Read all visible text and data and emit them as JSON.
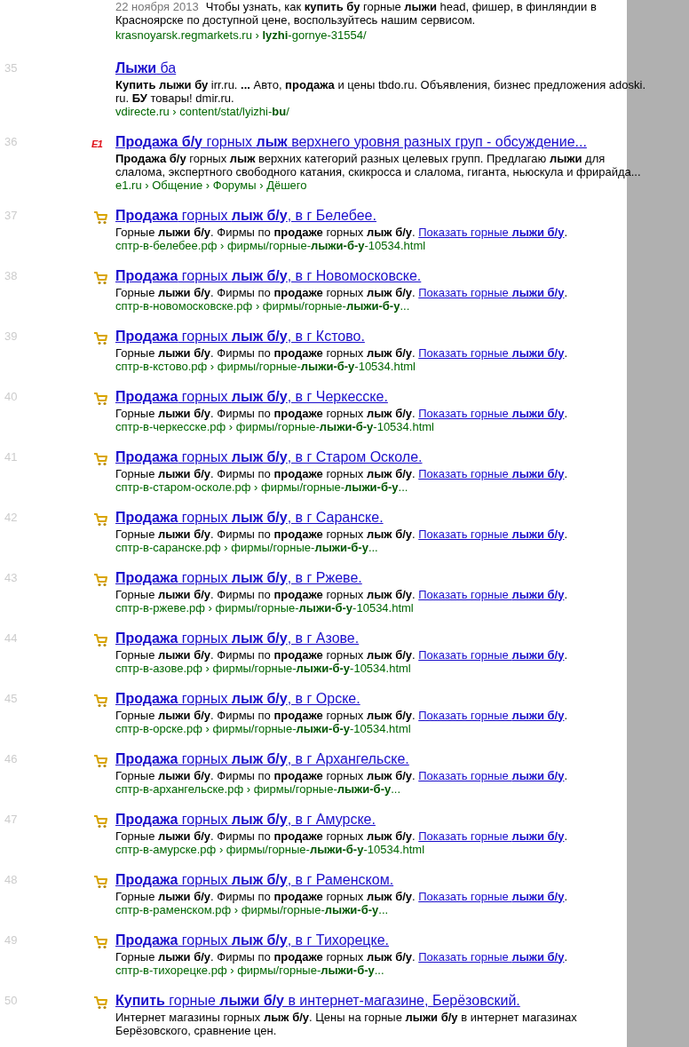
{
  "partial_result": {
    "date": "22 ноября 2013",
    "snippet_lines": [
      "Чтобы узнать, как **купить бу** горные **лыжи** head, фишер, в финляндии в",
      "Красноярске по доступной цене, воспользуйтесь нашим сервисом."
    ],
    "url": "krasnoyarsk.regmarkets.ru › **lyzhi**-gornye-31554/"
  },
  "results": [
    {
      "number": "35",
      "favicon": {
        "kind": "none"
      },
      "title": "**Лыжи** ба",
      "snippet": "**Купить лыжи бу** irr.ru. **...** Авто, **продажа** и цены tbdo.ru. Объявления, бизнес предложения adoski. ru. **БУ** товары! dmir.ru.",
      "url": "vdirecte.ru › content/stat/lyizhi-**bu**/"
    },
    {
      "number": "36",
      "favicon": {
        "kind": "text",
        "text": "E1"
      },
      "title": "**Продажа б/у** горных **лыж** верхнего уровня разных груп - обсуждение...",
      "snippet": "**Продажа б/у** горных **лыж** верхних категорий разных целевых групп. Предлагаю **лыжи** для слалома, экспертного свободного катания, скикросса и слалома, гиганта, ньюскула и фрирайда...",
      "url": "e1.ru › Общение › Форумы › Дёшего"
    },
    {
      "number": "37",
      "favicon": {
        "kind": "cart"
      },
      "title": "**Продажа** горных **лыж б/у**, в г Белебее.",
      "snippet": "Горные **лыжи б/у**. Фирмы по **продаже** горных **лыж б/у**.",
      "more_link": "Показать горные **лыжи б/у**",
      "more_tail": ".",
      "url": "сптр-в-белебее.рф › фирмы/горные-**лыжи-б-у**-10534.html"
    },
    {
      "number": "38",
      "favicon": {
        "kind": "cart"
      },
      "title": "**Продажа** горных **лыж б/у**, в г Новомосковске.",
      "snippet": "Горные **лыжи б/у**. Фирмы по **продаже** горных **лыж б/у**.",
      "more_link": "Показать горные **лыжи б/у**",
      "more_tail": ".",
      "url": "сптр-в-новомосковске.рф › фирмы/горные-**лыжи-б-у**..."
    },
    {
      "number": "39",
      "favicon": {
        "kind": "cart"
      },
      "title": "**Продажа** горных **лыж б/у**, в г Кстово.",
      "snippet": "Горные **лыжи б/у**. Фирмы по **продаже** горных **лыж б/у**.",
      "more_link": "Показать горные **лыжи б/у**",
      "more_tail": ".",
      "url": "сптр-в-кстово.рф › фирмы/горные-**лыжи-б-у**-10534.html"
    },
    {
      "number": "40",
      "favicon": {
        "kind": "cart"
      },
      "title": "**Продажа** горных **лыж б/у**, в г Черкесске.",
      "snippet": "Горные **лыжи б/у**. Фирмы по **продаже** горных **лыж б/у**.",
      "more_link": "Показать горные **лыжи б/у**",
      "more_tail": ".",
      "url": "сптр-в-черкесске.рф › фирмы/горные-**лыжи-б-у**-10534.html"
    },
    {
      "number": "41",
      "favicon": {
        "kind": "cart"
      },
      "title": "**Продажа** горных **лыж б/у**, в г Старом Осколе.",
      "snippet": "Горные **лыжи б/у**. Фирмы по **продаже** горных **лыж б/у**.",
      "more_link": "Показать горные **лыжи б/у**",
      "more_tail": ".",
      "url": "сптр-в-старом-осколе.рф › фирмы/горные-**лыжи-б-у**..."
    },
    {
      "number": "42",
      "favicon": {
        "kind": "cart"
      },
      "title": "**Продажа** горных **лыж б/у**, в г Саранске.",
      "snippet": "Горные **лыжи б/у**. Фирмы по **продаже** горных **лыж б/у**.",
      "more_link": "Показать горные **лыжи б/у**",
      "more_tail": ".",
      "url": "сптр-в-саранске.рф › фирмы/горные-**лыжи-б-у**..."
    },
    {
      "number": "43",
      "favicon": {
        "kind": "cart"
      },
      "title": "**Продажа** горных **лыж б/у**, в г Ржеве.",
      "snippet": "Горные **лыжи б/у**. Фирмы по **продаже** горных **лыж б/у**.",
      "more_link": "Показать горные **лыжи б/у**",
      "more_tail": ".",
      "url": "сптр-в-ржеве.рф › фирмы/горные-**лыжи-б-у**-10534.html"
    },
    {
      "number": "44",
      "favicon": {
        "kind": "cart"
      },
      "title": "**Продажа** горных **лыж б/у**, в г Азове.",
      "snippet": "Горные **лыжи б/у**. Фирмы по **продаже** горных **лыж б/у**.",
      "more_link": "Показать горные **лыжи б/у**",
      "more_tail": ".",
      "url": "сптр-в-азове.рф › фирмы/горные-**лыжи-б-у**-10534.html"
    },
    {
      "number": "45",
      "favicon": {
        "kind": "cart"
      },
      "title": "**Продажа** горных **лыж б/у**, в г Орске.",
      "snippet": "Горные **лыжи б/у**. Фирмы по **продаже** горных **лыж б/у**.",
      "more_link": "Показать горные **лыжи б/у**",
      "more_tail": ".",
      "url": "сптр-в-орске.рф › фирмы/горные-**лыжи-б-у**-10534.html"
    },
    {
      "number": "46",
      "favicon": {
        "kind": "cart"
      },
      "title": "**Продажа** горных **лыж б/у**, в г Архангельске.",
      "snippet": "Горные **лыжи б/у**. Фирмы по **продаже** горных **лыж б/у**.",
      "more_link": "Показать горные **лыжи б/у**",
      "more_tail": ".",
      "url": "сптр-в-архангельске.рф › фирмы/горные-**лыжи-б-у**..."
    },
    {
      "number": "47",
      "favicon": {
        "kind": "cart"
      },
      "title": "**Продажа** горных **лыж б/у**, в г Амурске.",
      "snippet": "Горные **лыжи б/у**. Фирмы по **продаже** горных **лыж б/у**.",
      "more_link": "Показать горные **лыжи б/у**",
      "more_tail": ".",
      "url": "сптр-в-амурске.рф › фирмы/горные-**лыжи-б-у**-10534.html"
    },
    {
      "number": "48",
      "favicon": {
        "kind": "cart"
      },
      "title": "**Продажа** горных **лыж б/у**, в г Раменском.",
      "snippet": "Горные **лыжи б/у**. Фирмы по **продаже** горных **лыж б/у**.",
      "more_link": "Показать горные **лыжи б/у**",
      "more_tail": ".",
      "url": "сптр-в-раменском.рф › фирмы/горные-**лыжи-б-у**..."
    },
    {
      "number": "49",
      "favicon": {
        "kind": "cart"
      },
      "title": "**Продажа** горных **лыж б/у**, в г Тихорецке.",
      "snippet": "Горные **лыжи б/у**. Фирмы по **продаже** горных **лыж б/у**.",
      "more_link": "Показать горные **лыжи б/у**",
      "more_tail": ".",
      "url": "сптр-в-тихорецке.рф › фирмы/горные-**лыжи-б-у**..."
    },
    {
      "number": "50",
      "favicon": {
        "kind": "cart"
      },
      "title": "**Купить** горные **лыжи б/у** в интернет-магазине, Берёзовский.",
      "snippet": "Интернет магазины горных **лыж б/у**. Цены на горные **лыжи б/у** в интернет магазинах Берёзовского, сравнение цен."
    }
  ]
}
